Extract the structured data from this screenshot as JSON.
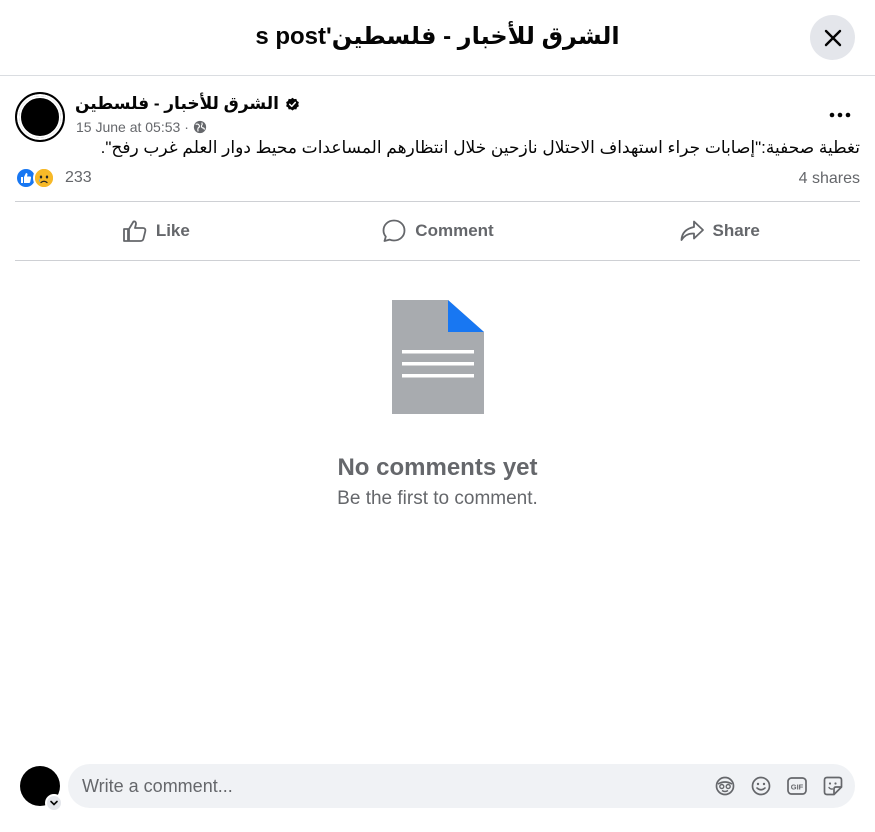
{
  "dialog": {
    "title": "الشرق للأخبار - فلسطين's post"
  },
  "post": {
    "author": "الشرق للأخبار - فلسطين",
    "timestamp": "15 June at 05:53 ·",
    "privacy_icon": "globe-icon",
    "text": "تغطية صحفية:\"إصابات جراء استهداف الاحتلال نازحين خلال انتظارهم المساعدات محيط دوار العلم غرب رفح\"."
  },
  "stats": {
    "reaction_icons": [
      "like-icon",
      "sad-icon"
    ],
    "reaction_count": "233",
    "shares": "4 shares"
  },
  "actions": {
    "like_label": "Like",
    "comment_label": "Comment",
    "share_label": "Share"
  },
  "empty_state": {
    "title": "No comments yet",
    "subtitle": "Be the first to comment."
  },
  "composer": {
    "placeholder": "Write a comment...",
    "icons": [
      "avatar-sticker-icon",
      "emoji-icon",
      "gif-icon",
      "sticker-icon"
    ]
  },
  "colors": {
    "accent": "#1877f2",
    "text_secondary": "#65676b",
    "doc_gray": "#a8abaf"
  }
}
